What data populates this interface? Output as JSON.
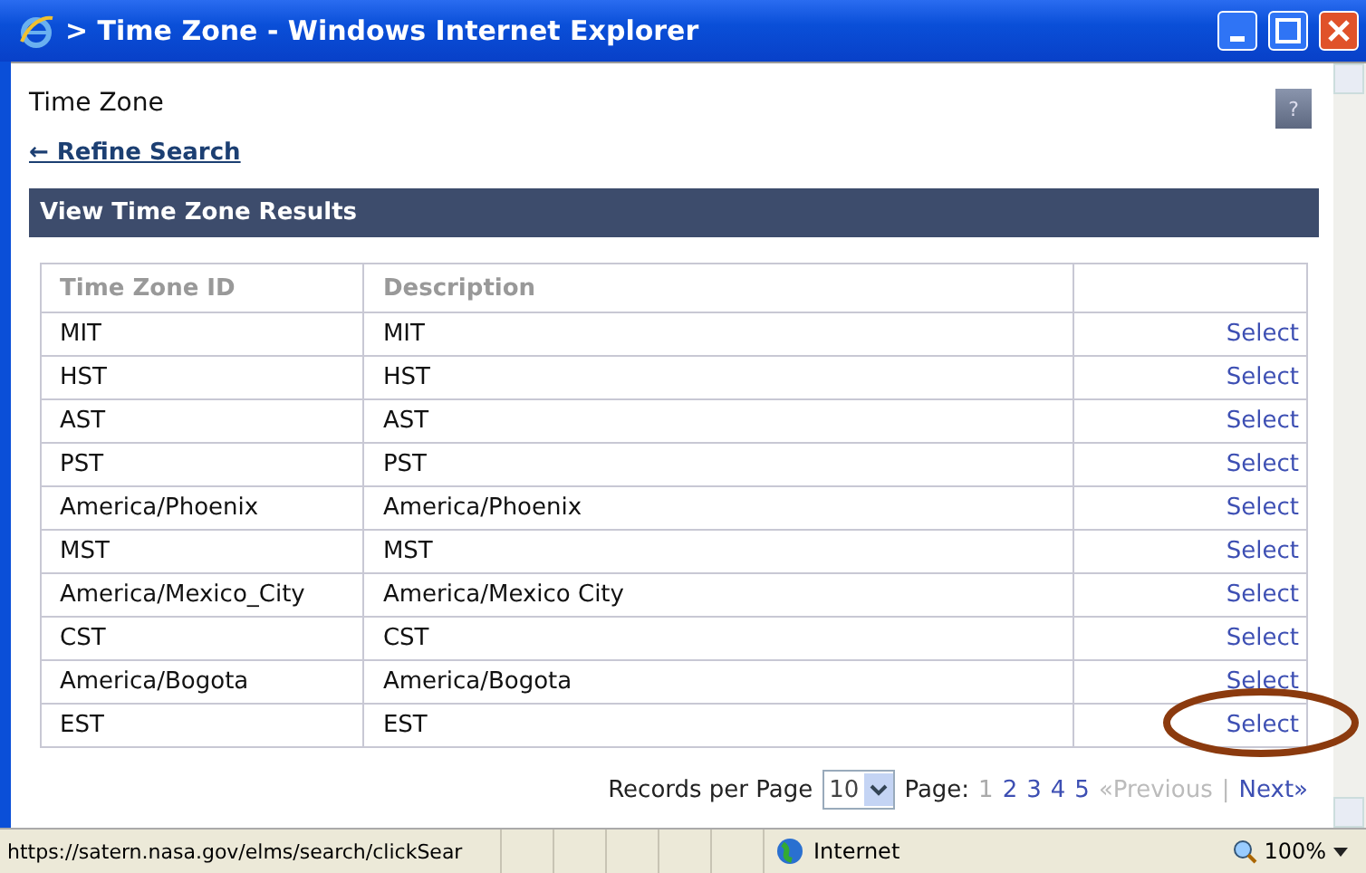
{
  "window": {
    "title": "> Time Zone - Windows Internet Explorer"
  },
  "page": {
    "title": "Time Zone",
    "help": "?",
    "back_link": "← Refine Search",
    "section_title": "View Time Zone Results"
  },
  "table": {
    "columns": [
      "Time Zone ID",
      "Description"
    ],
    "rows": [
      {
        "id": "MIT",
        "description": "MIT",
        "action": "Select"
      },
      {
        "id": "HST",
        "description": "HST",
        "action": "Select"
      },
      {
        "id": "AST",
        "description": "AST",
        "action": "Select"
      },
      {
        "id": "PST",
        "description": "PST",
        "action": "Select"
      },
      {
        "id": "America/Phoenix",
        "description": "America/Phoenix",
        "action": "Select"
      },
      {
        "id": "MST",
        "description": "MST",
        "action": "Select"
      },
      {
        "id": "America/Mexico_City",
        "description": "America/Mexico City",
        "action": "Select"
      },
      {
        "id": "CST",
        "description": "CST",
        "action": "Select"
      },
      {
        "id": "America/Bogota",
        "description": "America/Bogota",
        "action": "Select"
      },
      {
        "id": "EST",
        "description": "EST",
        "action": "Select",
        "circled": true
      }
    ]
  },
  "pagination": {
    "records_label": "Records per Page",
    "records_value": "10",
    "page_label": "Page:",
    "pages": [
      {
        "label": "1",
        "selected": true
      },
      {
        "label": "2",
        "selected": false
      },
      {
        "label": "3",
        "selected": false
      },
      {
        "label": "4",
        "selected": false
      },
      {
        "label": "5",
        "selected": false
      }
    ],
    "previous": {
      "label": "«Previous",
      "disabled": true
    },
    "separator": "|",
    "next": {
      "label": "Next»",
      "disabled": false
    }
  },
  "status_bar": {
    "url": "https://satern.nasa.gov/elms/search/clickSear",
    "zone": "Internet",
    "zoom": "100%"
  }
}
